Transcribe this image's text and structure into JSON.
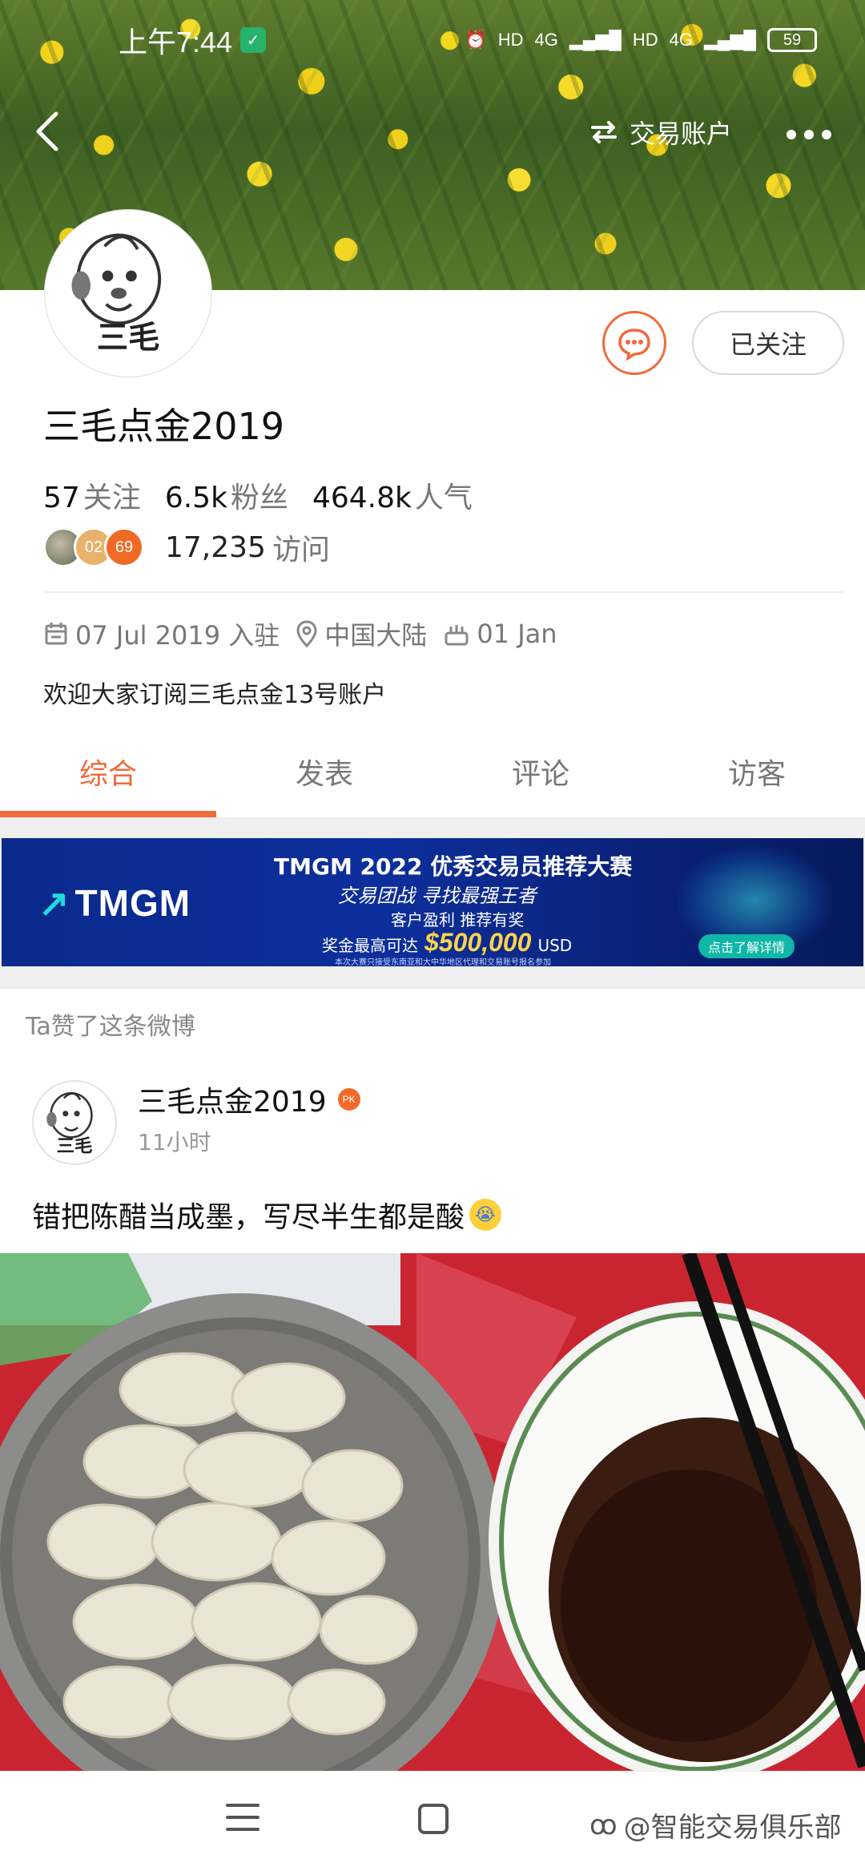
{
  "status_bar": {
    "time": "上午7:44",
    "network_1": "4G",
    "network_2": "4G",
    "battery": "59"
  },
  "nav": {
    "trade_account_label": "交易账户"
  },
  "profile": {
    "avatar_text": "三毛",
    "follow_button": "已关注",
    "username": "三毛点金2019",
    "stats": [
      {
        "value": "57",
        "label": "关注"
      },
      {
        "value": "6.5k",
        "label": "粉丝"
      },
      {
        "value": "464.8k",
        "label": "人气"
      }
    ],
    "visitor_badges": [
      "02",
      "69"
    ],
    "visits_count": "17,235",
    "visits_label": "访问",
    "joined": "07 Jul 2019 入驻",
    "location": "中国大陆",
    "birthday": "01 Jan",
    "bio": "欢迎大家订阅三毛点金13号账户"
  },
  "tabs": [
    "综合",
    "发表",
    "评论",
    "访客"
  ],
  "banner": {
    "logo": "TMGM",
    "title": "TMGM 2022 优秀交易员推荐大赛",
    "slogan": "交易团战 寻找最强王者",
    "line2": "客户盈利 推荐有奖",
    "prize_label": "奖金最高可达",
    "prize_amount": "$500,000",
    "prize_currency": "USD",
    "fine_print": "本次大赛只接受东南亚和大中华地区代理和交易账号报名参加",
    "cta": "点击了解详情"
  },
  "feed": {
    "liked_note": "Ta赞了这条微博",
    "author": "三毛点金2019",
    "author_badge": "PK",
    "time": "11小时",
    "text": "错把陈醋当成墨，写尽半生都是酸"
  },
  "bottom": {
    "watermark": "@智能交易俱乐部"
  },
  "colors": {
    "accent": "#f06a3a",
    "banner_bg": "#0d2f9c",
    "prize": "#ffd44a"
  }
}
